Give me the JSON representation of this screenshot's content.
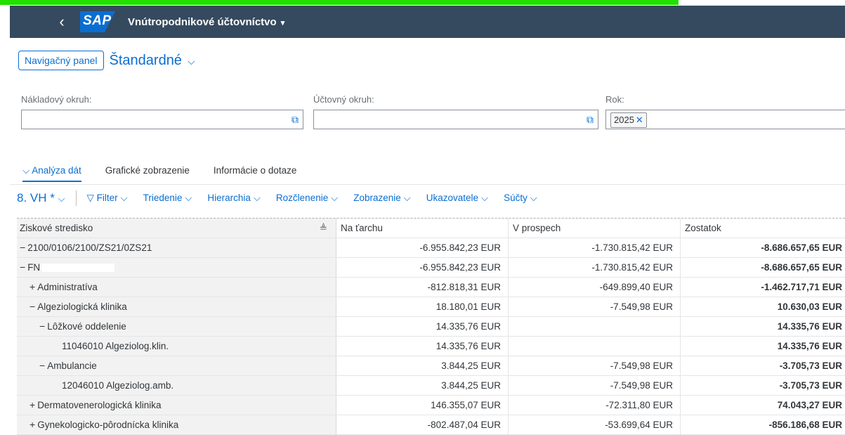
{
  "shell": {
    "back_icon": "chevron-left-icon",
    "logo": "SAP",
    "title": "Vnútropodnikové účtovníctvo",
    "title_caret": "▾"
  },
  "header": {
    "nav_button": "Navigačný panel",
    "variant": "Štandardné",
    "filters": [
      {
        "label": "Nákladový okruh:",
        "value": ""
      },
      {
        "label": "Účtovný okruh:",
        "value": ""
      },
      {
        "label": "Rok:",
        "token": "2025"
      }
    ]
  },
  "tabs": [
    "Analýza dát",
    "Grafické zobrazenie",
    "Informácie o dotaze"
  ],
  "toolbar": {
    "view": "8. VH *",
    "items": [
      "Filter",
      "Triedenie",
      "Hierarchia",
      "Rozčlenenie",
      "Zobrazenie",
      "Ukazovatele",
      "Súčty"
    ]
  },
  "table": {
    "headers": [
      "Ziskové stredisko",
      "Na ťarchu",
      "V prospech",
      "Zostatok"
    ],
    "rows": [
      {
        "toggle": "−",
        "label": "2100/0106/2100/ZS21/0ZS21",
        "debit": "-6.955.842,23 EUR",
        "credit": "-1.730.815,42 EUR",
        "balance": "-8.686.657,65 EUR"
      },
      {
        "toggle": "−",
        "label": "FN",
        "debit": "-6.955.842,23 EUR",
        "credit": "-1.730.815,42 EUR",
        "balance": "-8.686.657,65 EUR"
      },
      {
        "toggle": "+",
        "label": "Administratíva",
        "debit": "-812.818,31 EUR",
        "credit": "-649.899,40 EUR",
        "balance": "-1.462.717,71 EUR"
      },
      {
        "toggle": "−",
        "label": "Algeziologická klinika",
        "debit": "18.180,01 EUR",
        "credit": "-7.549,98 EUR",
        "balance": "10.630,03 EUR"
      },
      {
        "toggle": "−",
        "label": "Lôžkové oddelenie",
        "debit": "14.335,76 EUR",
        "credit": "",
        "balance": "14.335,76 EUR"
      },
      {
        "toggle": "",
        "label": "11046010 Algeziolog.klin.",
        "debit": "14.335,76 EUR",
        "credit": "",
        "balance": "14.335,76 EUR"
      },
      {
        "toggle": "−",
        "label": "Ambulancie",
        "debit": "3.844,25 EUR",
        "credit": "-7.549,98 EUR",
        "balance": "-3.705,73 EUR"
      },
      {
        "toggle": "",
        "label": "12046010 Algeziolog.amb.",
        "debit": "3.844,25 EUR",
        "credit": "-7.549,98 EUR",
        "balance": "-3.705,73 EUR"
      },
      {
        "toggle": "+",
        "label": "Dermatovenerologická klinika",
        "debit": "146.355,07 EUR",
        "credit": "-72.311,80 EUR",
        "balance": "74.043,27 EUR"
      },
      {
        "toggle": "+",
        "label": "Gynekologicko-pôrodnícka klinika",
        "debit": "-802.487,04 EUR",
        "credit": "-53.699,64 EUR",
        "balance": "-856.186,68 EUR"
      }
    ]
  },
  "colors": {
    "shell_bg": "#354a5f",
    "accent": "#0a6ed1",
    "highlight": "#22e000"
  }
}
